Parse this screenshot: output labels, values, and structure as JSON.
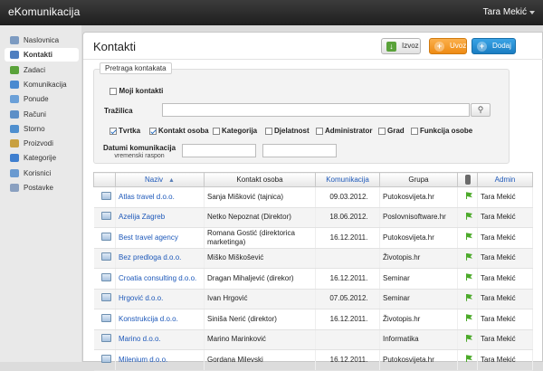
{
  "app": {
    "title": "eKomunikacija",
    "user": "Tara Mekić"
  },
  "sidebar": {
    "items": [
      {
        "label": "Naslovnica",
        "icon": "home-icon",
        "color": "#7d9bc1"
      },
      {
        "label": "Kontakti",
        "icon": "contacts-icon",
        "color": "#4f7fc0",
        "active": true
      },
      {
        "label": "Zadaci",
        "icon": "tasks-icon",
        "color": "#5aa23a"
      },
      {
        "label": "Komunikacija",
        "icon": "communication-icon",
        "color": "#4a8ad0"
      },
      {
        "label": "Ponude",
        "icon": "offers-icon",
        "color": "#6ba0d8"
      },
      {
        "label": "Računi",
        "icon": "invoices-icon",
        "color": "#5d8fc7"
      },
      {
        "label": "Storno",
        "icon": "storno-icon",
        "color": "#4f8fcf"
      },
      {
        "label": "Proizvodi",
        "icon": "products-icon",
        "color": "#c8a040"
      },
      {
        "label": "Kategorije",
        "icon": "categories-icon",
        "color": "#3f7fcf"
      },
      {
        "label": "Korisnici",
        "icon": "users-icon",
        "color": "#6a9ad0"
      },
      {
        "label": "Postavke",
        "icon": "settings-icon",
        "color": "#8aa0c0"
      }
    ]
  },
  "page": {
    "title": "Kontakti"
  },
  "toolbar": {
    "export_label": "Izvoz",
    "import_label": "Uvoz",
    "add_label": "Dodaj"
  },
  "filter": {
    "legend": "Pretraga kontakata",
    "moji_label": "Moji kontakti",
    "search_label": "Tražilica",
    "search_value": "",
    "columns": [
      {
        "label": "Tvrtka",
        "checked": true
      },
      {
        "label": "Kontakt osoba",
        "checked": true
      },
      {
        "label": "Kategorija",
        "checked": false
      },
      {
        "label": "Djelatnost",
        "checked": false
      },
      {
        "label": "Administrator",
        "checked": false
      },
      {
        "label": "Grad",
        "checked": false
      },
      {
        "label": "Funkcija osobe",
        "checked": false
      }
    ],
    "date_label": "Datumi komunikacija",
    "date_sub": "vremenski raspon"
  },
  "table": {
    "headers": {
      "naziv": "Naziv",
      "kontakt": "Kontakt osoba",
      "komunikacija": "Komunikacija",
      "grupa": "Grupa",
      "admin": "Admin"
    },
    "rows": [
      {
        "naziv": "Atlas travel d.o.o.",
        "kontakt": "Sanja Mišković (tajnica)",
        "datum": "09.03.2012.",
        "grupa": "Putokosvijeta.hr",
        "admin": "Tara Mekić"
      },
      {
        "naziv": "Azelija Zagreb",
        "kontakt": "Netko Nepoznat (Direktor)",
        "datum": "18.06.2012.",
        "grupa": "Poslovnisoftware.hr",
        "admin": "Tara Mekić"
      },
      {
        "naziv": "Best travel agency",
        "kontakt": "Romana Gostić (direktorica marketinga)",
        "datum": "16.12.2011.",
        "grupa": "Putokosvijeta.hr",
        "admin": "Tara Mekić"
      },
      {
        "naziv": "Bez predloga d.o.o.",
        "kontakt": "Miško Miškošević",
        "datum": "",
        "grupa": "Životopis.hr",
        "admin": "Tara Mekić"
      },
      {
        "naziv": "Croatia consulting d.o.o.",
        "kontakt": "Dragan Mihaljević (direkor)",
        "datum": "16.12.2011.",
        "grupa": "Seminar",
        "admin": "Tara Mekić"
      },
      {
        "naziv": "Hrgović d.o.o.",
        "kontakt": "Ivan Hrgović",
        "datum": "07.05.2012.",
        "grupa": "Seminar",
        "admin": "Tara Mekić"
      },
      {
        "naziv": "Konstrukcija d.o.o.",
        "kontakt": "Siniša Nerić (direktor)",
        "datum": "16.12.2011.",
        "grupa": "Životopis.hr",
        "admin": "Tara Mekić"
      },
      {
        "naziv": "Marino d.o.o.",
        "kontakt": "Marino Marinković",
        "datum": "",
        "grupa": "Informatika",
        "admin": "Tara Mekić"
      },
      {
        "naziv": "Milenium d.o.o.",
        "kontakt": "Gordana Milevski",
        "datum": "16.12.2011.",
        "grupa": "Putokosvijeta.hr",
        "admin": "Tara Mekić"
      }
    ]
  }
}
